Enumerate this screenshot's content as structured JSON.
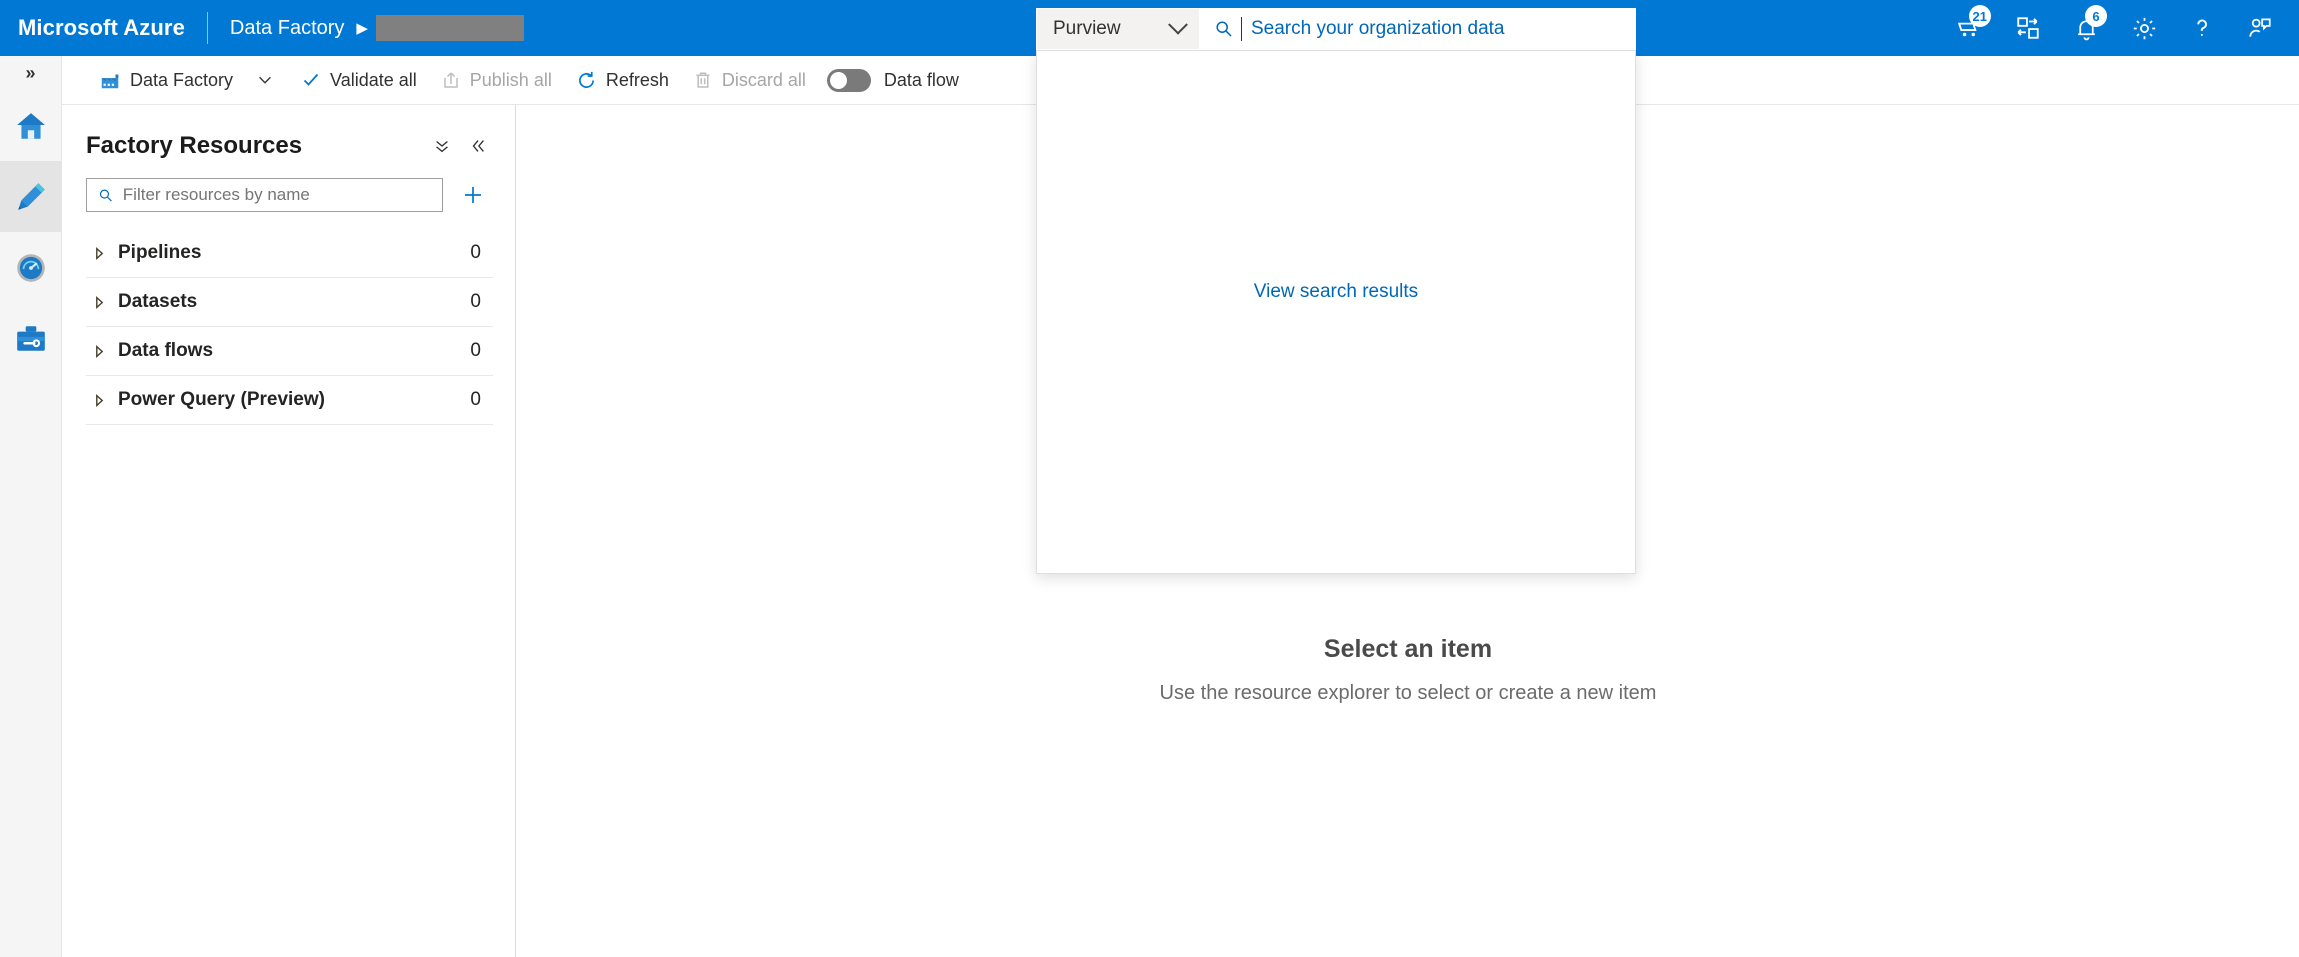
{
  "header": {
    "brand": "Microsoft Azure",
    "breadcrumb": {
      "service": "Data Factory",
      "arrow": "▶",
      "redacted_label": ""
    },
    "search": {
      "scope_label": "Purview",
      "scope_icon": "chevron-down-icon",
      "search_icon": "search-icon",
      "placeholder": "Search your organization data",
      "value": "",
      "dropdown": {
        "view_results_label": "View search results"
      }
    },
    "icons": [
      {
        "name": "cloud-shell-cart-icon",
        "badge": "21"
      },
      {
        "name": "directories-subscriptions-icon",
        "badge": ""
      },
      {
        "name": "notifications-bell-icon",
        "badge": "6"
      },
      {
        "name": "settings-gear-icon",
        "badge": ""
      },
      {
        "name": "help-question-icon",
        "badge": ""
      },
      {
        "name": "feedback-person-icon",
        "badge": ""
      }
    ]
  },
  "left_rail": {
    "expand_label": "»",
    "items": [
      {
        "name": "rail-item-home",
        "icon": "home-icon",
        "active": false
      },
      {
        "name": "rail-item-author",
        "icon": "pencil-icon",
        "active": true
      },
      {
        "name": "rail-item-monitor",
        "icon": "gauge-icon",
        "active": false
      },
      {
        "name": "rail-item-manage",
        "icon": "toolbox-icon",
        "active": false
      }
    ]
  },
  "toolbar": {
    "factory_label": "Data Factory",
    "factory_icon": "factory-icon",
    "factory_chevron": "chevron-down-icon",
    "validate_all": "Validate all",
    "publish_all": "Publish all",
    "refresh": "Refresh",
    "discard_all": "Discard all",
    "dataflow_toggle_label": "Data flow",
    "toggle_state": "off"
  },
  "factory_resources": {
    "title": "Factory Resources",
    "collapse_all_icon": "double-chevron-down-icon",
    "collapse_panel_icon": "double-chevron-left-icon",
    "filter_placeholder": "Filter resources by name",
    "filter_value": "",
    "add_icon": "plus-icon",
    "tree": [
      {
        "label": "Pipelines",
        "count": "0"
      },
      {
        "label": "Datasets",
        "count": "0"
      },
      {
        "label": "Data flows",
        "count": "0"
      },
      {
        "label": "Power Query (Preview)",
        "count": "0"
      }
    ]
  },
  "canvas": {
    "empty_state": {
      "illustration": "isometric-data-cylinders-illustration",
      "title": "Select an item",
      "subtitle": "Use the resource explorer to select or create a new item"
    }
  },
  "colors": {
    "azure_blue": "#0078D4",
    "link_blue": "#0067b8",
    "toggle_off_gray": "#7a7a7a",
    "redacted_gray": "#808080"
  }
}
